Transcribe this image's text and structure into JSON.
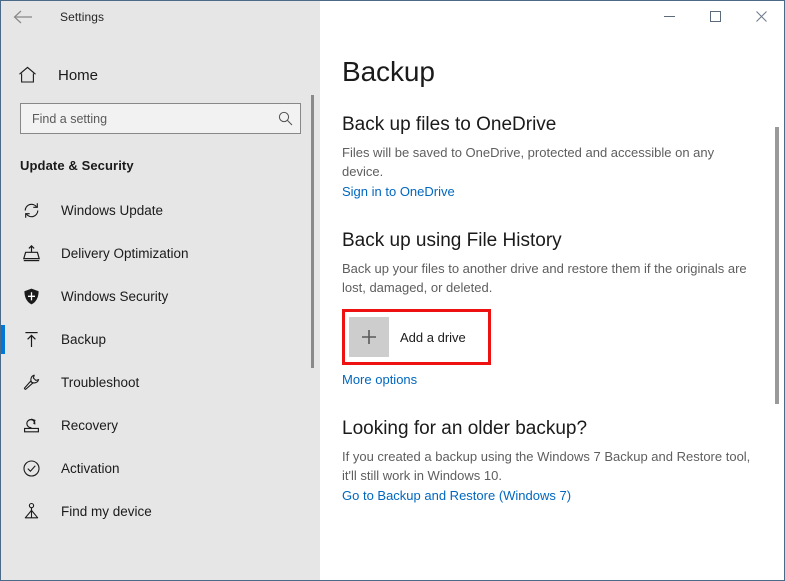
{
  "window": {
    "title": "Settings",
    "back_icon": "back-arrow-icon",
    "controls": {
      "minimize": "minimize-icon",
      "maximize": "maximize-icon",
      "close": "close-icon"
    }
  },
  "sidebar": {
    "home": {
      "label": "Home",
      "icon": "home-icon"
    },
    "search": {
      "placeholder": "Find a setting",
      "value": "",
      "icon": "search-icon"
    },
    "category": "Update & Security",
    "items": [
      {
        "label": "Windows Update",
        "icon": "refresh-icon",
        "selected": false
      },
      {
        "label": "Delivery Optimization",
        "icon": "delivery-icon",
        "selected": false
      },
      {
        "label": "Windows Security",
        "icon": "shield-icon",
        "selected": false
      },
      {
        "label": "Backup",
        "icon": "upload-arrow-icon",
        "selected": true
      },
      {
        "label": "Troubleshoot",
        "icon": "wrench-icon",
        "selected": false
      },
      {
        "label": "Recovery",
        "icon": "recovery-icon",
        "selected": false
      },
      {
        "label": "Activation",
        "icon": "check-circle-icon",
        "selected": false
      },
      {
        "label": "Find my device",
        "icon": "find-device-icon",
        "selected": false
      }
    ]
  },
  "main": {
    "page_title": "Backup",
    "sections": [
      {
        "heading": "Back up files to OneDrive",
        "description": "Files will be saved to OneDrive, protected and accessible on any device.",
        "link": "Sign in to OneDrive"
      },
      {
        "heading": "Back up using File History",
        "description": "Back up your files to another drive and restore them if the originals are lost, damaged, or deleted.",
        "add_drive_label": "Add a drive",
        "add_drive_icon": "plus-icon",
        "link": "More options"
      },
      {
        "heading": "Looking for an older backup?",
        "description": "If you created a backup using the Windows 7 Backup and Restore tool, it'll still work in Windows 10.",
        "link": "Go to Backup and Restore (Windows 7)"
      }
    ]
  },
  "colors": {
    "accent": "#0078d7",
    "link": "#0067c0",
    "highlight": "#ee1111",
    "sidebar_bg": "#e6e6e6",
    "window_border": "#4a6a88"
  }
}
